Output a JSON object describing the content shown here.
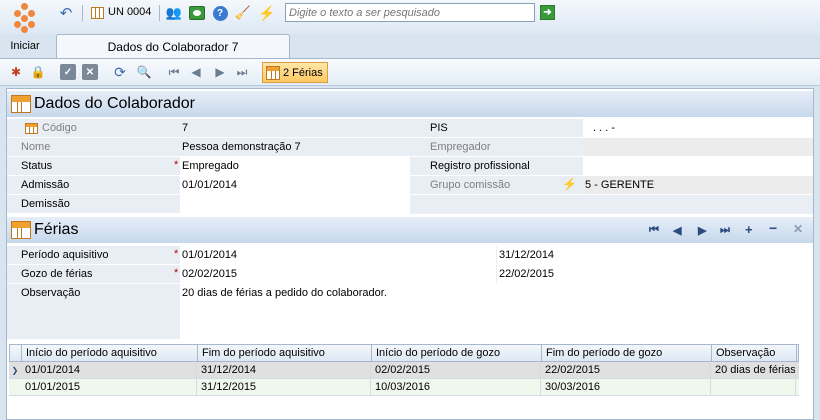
{
  "toolbar": {
    "un_label": "UN 0004",
    "search_placeholder": "Digite o texto a ser pesquisado",
    "start_label": "Iniciar"
  },
  "tabs": [
    {
      "label": "Dados do Colaborador 7"
    }
  ],
  "toolbar2": {
    "ferias_button": "2 Férias"
  },
  "colaborador": {
    "title": "Dados do Colaborador",
    "codigo_label": "Código",
    "codigo": "7",
    "nome_label": "Nome",
    "nome": "Pessoa demonstração 7",
    "status_label": "Status",
    "status": "Empregado",
    "admissao_label": "Admissão",
    "admissao": "01/01/2014",
    "demissao_label": "Demissão",
    "demissao": "",
    "pis_label": "PIS",
    "pis": ".  .  .  -",
    "empregador_label": "Empregador",
    "empregador": "",
    "registro_label": "Registro profissional",
    "registro": "",
    "grupo_label": "Grupo comissão",
    "grupo": "5 - GERENTE"
  },
  "ferias": {
    "title": "Férias",
    "periodo_label": "Período aquisitivo",
    "periodo_inicio": "01/01/2014",
    "periodo_fim": "31/12/2014",
    "gozo_label": "Gozo de férias",
    "gozo_inicio": "02/02/2015",
    "gozo_fim": "22/02/2015",
    "obs_label": "Observação",
    "obs": "20 dias de férias a pedido do colaborador."
  },
  "grid": {
    "headers": [
      "Início do período aquisitivo",
      "Fim do período aquisitivo",
      "Início do período de gozo",
      "Fim do período de gozo",
      "Observação"
    ],
    "rows": [
      [
        "01/01/2014",
        "31/12/2014",
        "02/02/2015",
        "22/02/2015",
        "20 dias de férias"
      ],
      [
        "01/01/2015",
        "31/12/2015",
        "10/03/2016",
        "30/03/2016",
        ""
      ]
    ]
  },
  "colors": {
    "accent": "#f0873a",
    "header_blue": "#c6d8ec",
    "selected_row": "#fff0c0"
  }
}
